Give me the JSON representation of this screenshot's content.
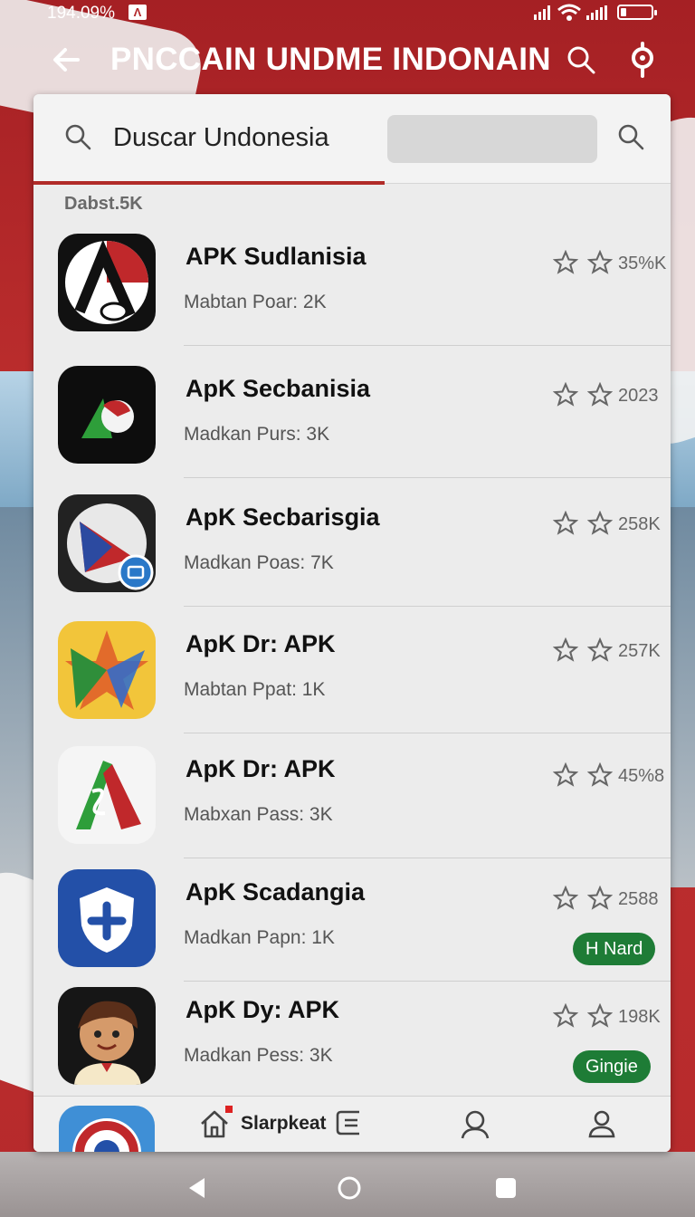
{
  "status": {
    "battery_percent": "194.09%",
    "app_badge": "Λ",
    "icons": [
      "signal-icon",
      "wifi-icon",
      "signal-icon",
      "battery-icon"
    ],
    "battery_level": 0.2
  },
  "appbar": {
    "title": "PNCCAIN UNDME INDONAIN",
    "icons": [
      "back-arrow-icon",
      "search-icon",
      "location-icon"
    ]
  },
  "search": {
    "query": "Duscar Undonesia"
  },
  "section_label": "Dabst.5K",
  "apps": [
    {
      "name": "APK Sudlanisia",
      "subtitle": "Mabtan Poar: 2K",
      "count": "35%K",
      "badge": ""
    },
    {
      "name": "ApK Secbanisia",
      "subtitle": "Madkan Purs: 3K",
      "count": "2023",
      "badge": ""
    },
    {
      "name": "ApK Secbarisgia",
      "subtitle": "Madkan Poas: 7K",
      "count": "258K",
      "badge": ""
    },
    {
      "name": "ApK Dr: APK",
      "subtitle": "Mabtan Ppat: 1K",
      "count": "257K",
      "badge": ""
    },
    {
      "name": "ApK Dr: APK",
      "subtitle": "Mabxan Pass: 3K",
      "count": "45%8",
      "badge": ""
    },
    {
      "name": "ApK Scadangia",
      "subtitle": "Madkan Papn: 1K",
      "count": "2588",
      "badge": "H Nard"
    },
    {
      "name": "ApK Dy: APK",
      "subtitle": "Madkan Pess: 3K",
      "count": "198K",
      "badge": "Gingie"
    }
  ],
  "tabbar": {
    "home_label": "Slarpkeat"
  },
  "colors": {
    "accent": "#b12b28",
    "badge_green": "#1e7c36"
  }
}
